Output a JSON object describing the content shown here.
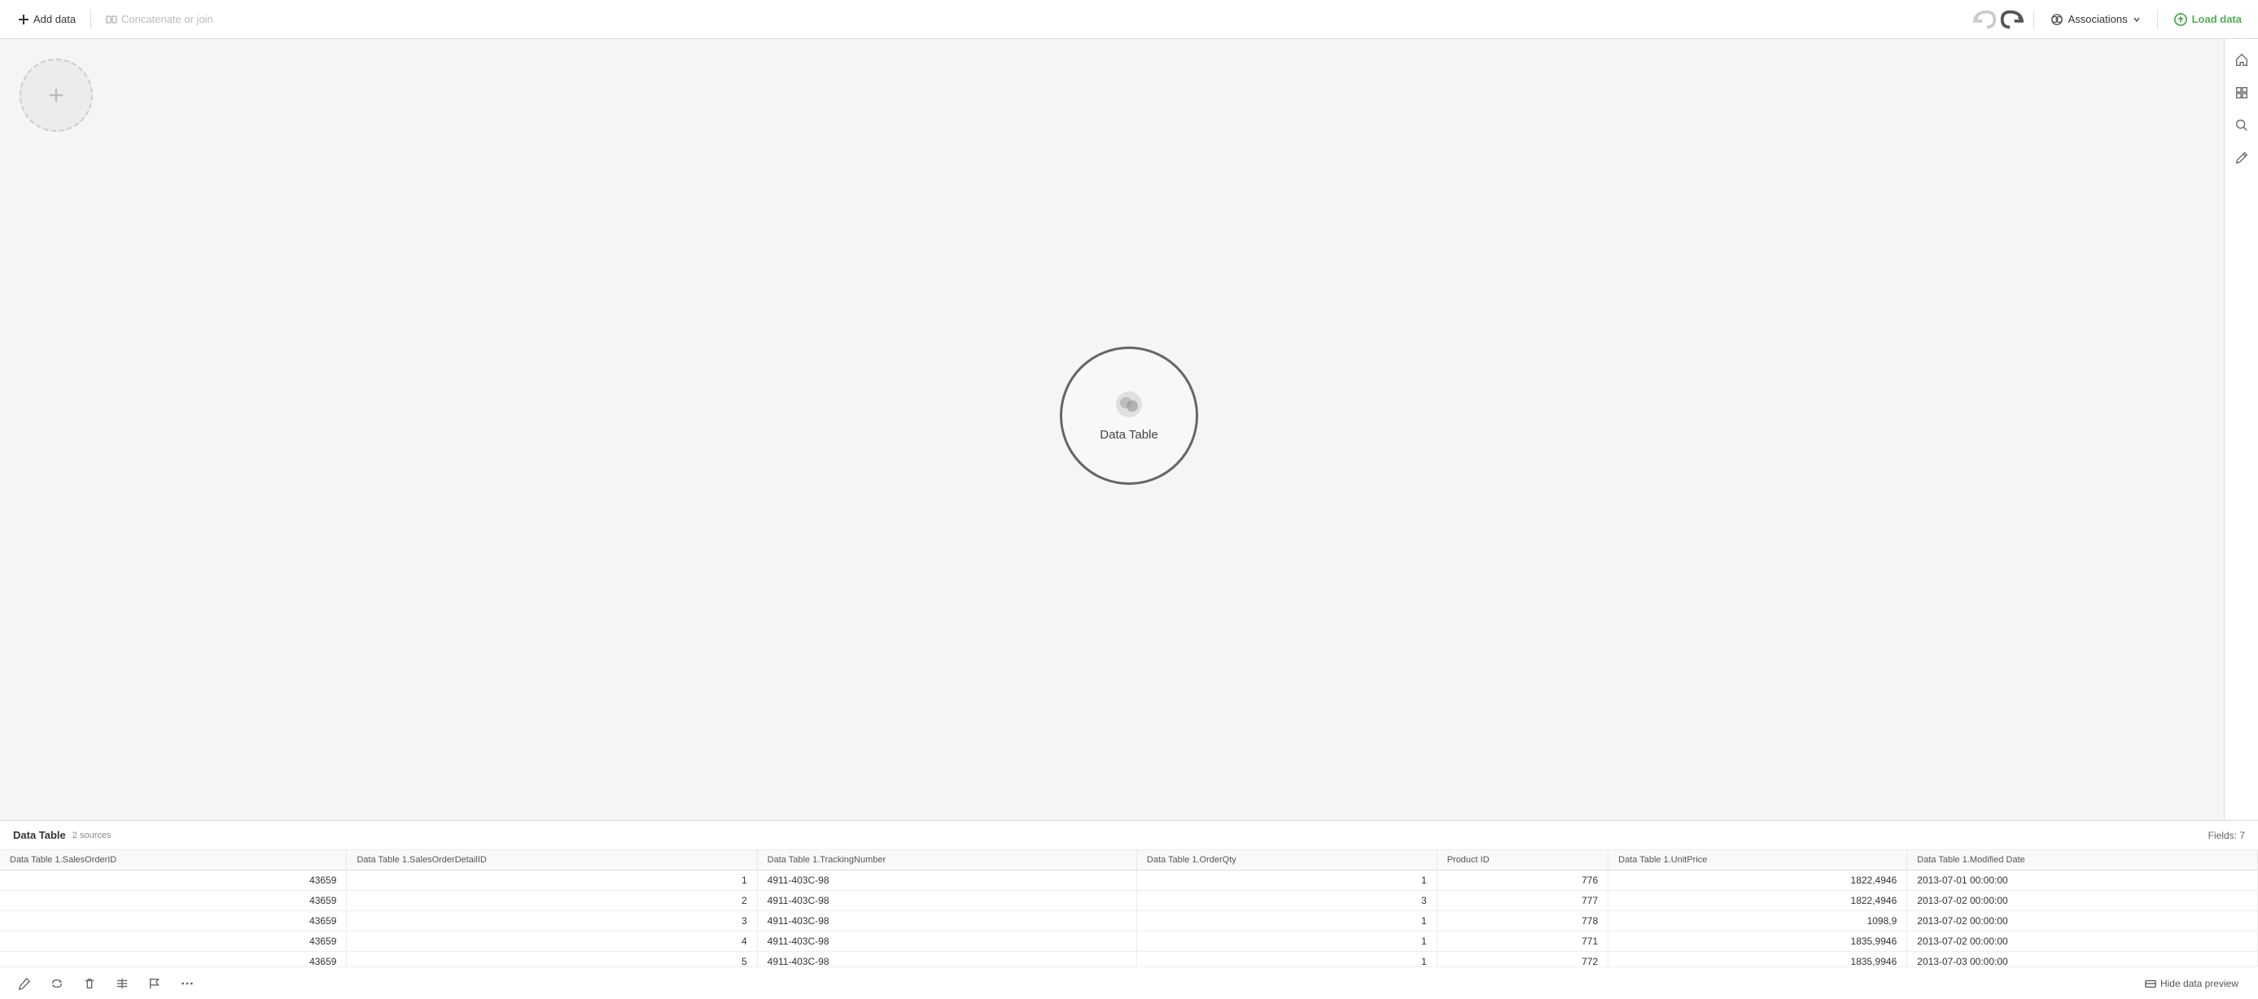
{
  "toolbar": {
    "add_data_label": "Add data",
    "concatenate_label": "Concatenate or join",
    "associations_label": "Associations",
    "load_data_label": "Load data"
  },
  "canvas": {
    "add_circle_icon": "+",
    "data_table_label": "Data Table"
  },
  "bottom_panel": {
    "title": "Data Table",
    "sources": "2 sources",
    "fields_label": "Fields: 7",
    "hide_preview": "Hide data preview"
  },
  "table": {
    "columns": [
      "Data Table 1.SalesOrderID",
      "Data Table 1.SalesOrderDetailID",
      "Data Table 1.TrackingNumber",
      "Data Table 1.OrderQty",
      "Product ID",
      "Data Table 1.UnitPrice",
      "Data Table 1.Modified Date"
    ],
    "rows": [
      [
        "43659",
        "1",
        "4911-403C-98",
        "1",
        "776",
        "1822,4946",
        "2013-07-01 00:00:00"
      ],
      [
        "43659",
        "2",
        "4911-403C-98",
        "3",
        "777",
        "1822,4946",
        "2013-07-02 00:00:00"
      ],
      [
        "43659",
        "3",
        "4911-403C-98",
        "1",
        "778",
        "1098,9",
        "2013-07-02 00:00:00"
      ],
      [
        "43659",
        "4",
        "4911-403C-98",
        "1",
        "771",
        "1835,9946",
        "2013-07-02 00:00:00"
      ],
      [
        "43659",
        "5",
        "4911-403C-98",
        "1",
        "772",
        "1835,9946",
        "2013-07-03 00:00:00"
      ]
    ]
  },
  "icons": {
    "plus": "+",
    "undo": "↩",
    "redo": "↪",
    "home": "⌂",
    "search": "🔍",
    "filter": "⊞",
    "pen": "✎",
    "refresh": "↻",
    "trash": "🗑",
    "split": "⇔",
    "flag": "⚑",
    "more": "···",
    "eye_off": "◫"
  }
}
